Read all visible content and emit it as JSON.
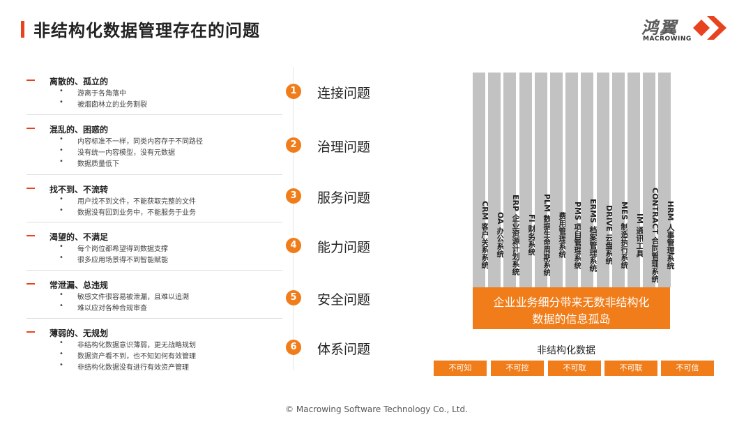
{
  "header": {
    "title": "非结构化数据管理存在的问题"
  },
  "logo": {
    "cn": "鸿翼",
    "en": "MACROWING"
  },
  "problems": [
    {
      "head": "离散的、孤立的",
      "bullets": [
        "游离于各角落中",
        "被烟囱林立的业务割裂"
      ]
    },
    {
      "head": "混乱的、困惑的",
      "bullets": [
        "内容标准不一样，同类内容存于不同路径",
        "没有统一内容模型，没有元数据",
        "数据质量低下"
      ]
    },
    {
      "head": "找不到、不流转",
      "bullets": [
        "用户找不到文件，不能获取完整的文件",
        "数据没有回到业务中，不能服务于业务"
      ]
    },
    {
      "head": "渴望的、不满足",
      "bullets": [
        "每个岗位都希望得到数据支撑",
        "很多应用场景得不到智能赋能"
      ]
    },
    {
      "head": "常泄漏、总违规",
      "bullets": [
        "敏感文件很容易被泄漏，且难以追溯",
        "难以应对各种合规审查"
      ]
    },
    {
      "head": "薄弱的、无规划",
      "bullets": [
        "非结构化数据意识薄弱，更无战略规划",
        "数据资产看不到，也不知如何有效管理",
        "非结构化数据没有进行有效资产管理"
      ]
    }
  ],
  "issues": [
    {
      "num": "1",
      "label": "连接问题"
    },
    {
      "num": "2",
      "label": "治理问题"
    },
    {
      "num": "3",
      "label": "服务问题"
    },
    {
      "num": "4",
      "label": "能力问题"
    },
    {
      "num": "5",
      "label": "安全问题"
    },
    {
      "num": "6",
      "label": "体系问题"
    }
  ],
  "pillars": [
    "CRM 客户关系系统",
    "OA 办公系统",
    "ERP 企业资源计划系统",
    "FI 财务系统",
    "PLM 数据生命周期系统",
    "费用管理系统",
    "PMS 项目管理系统",
    "ERMS 档案管理系统",
    "DRIVE 云盘系统",
    "MES 制造执行系统",
    "IM 通讯工具",
    "CONTRACT 合同管理系统",
    "HRM 人事管理系统"
  ],
  "banner": {
    "line1": "企业业务细分带来无数非结构化",
    "line2": "数据的信息孤岛"
  },
  "unstructured": {
    "label": "非结构化数据",
    "tags": [
      "不可知",
      "不可控",
      "不可取",
      "不可联",
      "不可信"
    ]
  },
  "footer": "© Macrowing Software Technology Co., Ltd.",
  "colors": {
    "accent": "#f07d1a",
    "title_bar": "#e8431f",
    "pillar": "#c2c2c2"
  }
}
